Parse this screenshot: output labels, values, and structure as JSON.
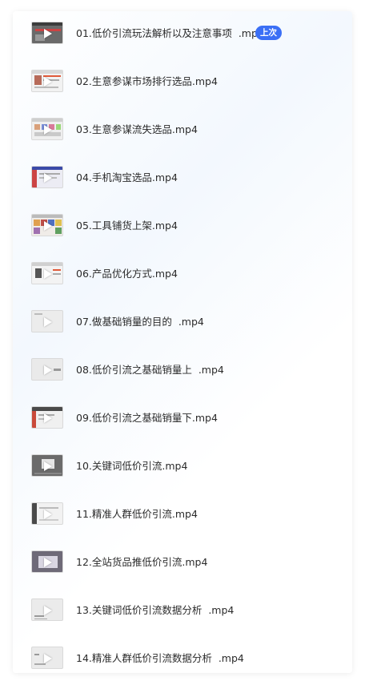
{
  "episodes": [
    {
      "title": "01.低价引流玩法解析以及注意事项  .mp4",
      "badge": "上次"
    },
    {
      "title": "02.生意参谋市场排行选品.mp4"
    },
    {
      "title": "03.生意参谋流失选品.mp4"
    },
    {
      "title": "04.手机淘宝选品.mp4"
    },
    {
      "title": "05.工具铺货上架.mp4"
    },
    {
      "title": "06.产品优化方式.mp4"
    },
    {
      "title": "07.做基础销量的目的  .mp4"
    },
    {
      "title": "08.低价引流之基础销量上  .mp4"
    },
    {
      "title": "09.低价引流之基础销量下.mp4"
    },
    {
      "title": "10.关键词低价引流.mp4"
    },
    {
      "title": "11.精准人群低价引流.mp4"
    },
    {
      "title": "12.全站货品推低价引流.mp4"
    },
    {
      "title": "13.关键词低价引流数据分析  .mp4"
    },
    {
      "title": "14.精准人群低价引流数据分析  .mp4"
    }
  ],
  "colors": {
    "badge_bg": "#3b6ff5",
    "text": "#2b2b2b"
  },
  "icons": {
    "thumbnail_play": "play-icon"
  }
}
